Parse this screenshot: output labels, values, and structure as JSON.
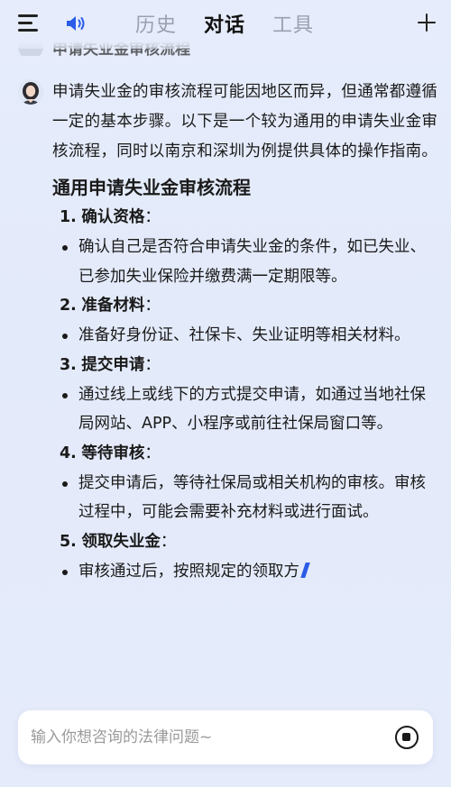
{
  "header": {
    "tabs": [
      {
        "label": "历史",
        "active": false
      },
      {
        "label": "对话",
        "active": true
      },
      {
        "label": "工具",
        "active": false
      }
    ],
    "icons": {
      "menu": "menu-icon",
      "speaker": "speaker-icon",
      "new_chat": "plus-icon"
    }
  },
  "previous_message": {
    "text": "申请失业金审核流程"
  },
  "answer": {
    "intro": "申请失业金的审核流程可能因地区而异，但通常都遵循一定的基本步骤。以下是一个较为通用的申请失业金审核流程，同时以南京和深圳为例提供具体的操作指南。",
    "section_title": "通用申请失业金审核流程",
    "steps": [
      {
        "num": "1.",
        "title": "确认资格",
        "colon": "：",
        "bullets": [
          "确认自己是否符合申请失业金的条件，如已失业、已参加失业保险并缴费满一定期限等。"
        ]
      },
      {
        "num": "2.",
        "title": "准备材料",
        "colon": "：",
        "bullets": [
          "准备好身份证、社保卡、失业证明等相关材料。"
        ]
      },
      {
        "num": "3.",
        "title": "提交申请",
        "colon": "：",
        "bullets": [
          "通过线上或线下的方式提交申请，如通过当地社保局网站、APP、小程序或前往社保局窗口等。"
        ]
      },
      {
        "num": "4.",
        "title": "等待审核",
        "colon": "：",
        "bullets": [
          "提交申请后，等待社保局或相关机构的审核。审核过程中，可能会需要补充材料或进行面试。"
        ]
      },
      {
        "num": "5.",
        "title": "领取失业金",
        "colon": "：",
        "bullets": [
          "审核通过后，按照规定的领取方"
        ]
      }
    ]
  },
  "input": {
    "placeholder": "输入你想咨询的法律问题~",
    "value": ""
  },
  "colors": {
    "background": "#e6ecfb",
    "active_tab": "#111111",
    "inactive_tab": "#9aa0b0",
    "cursor": "#2c5be6"
  }
}
